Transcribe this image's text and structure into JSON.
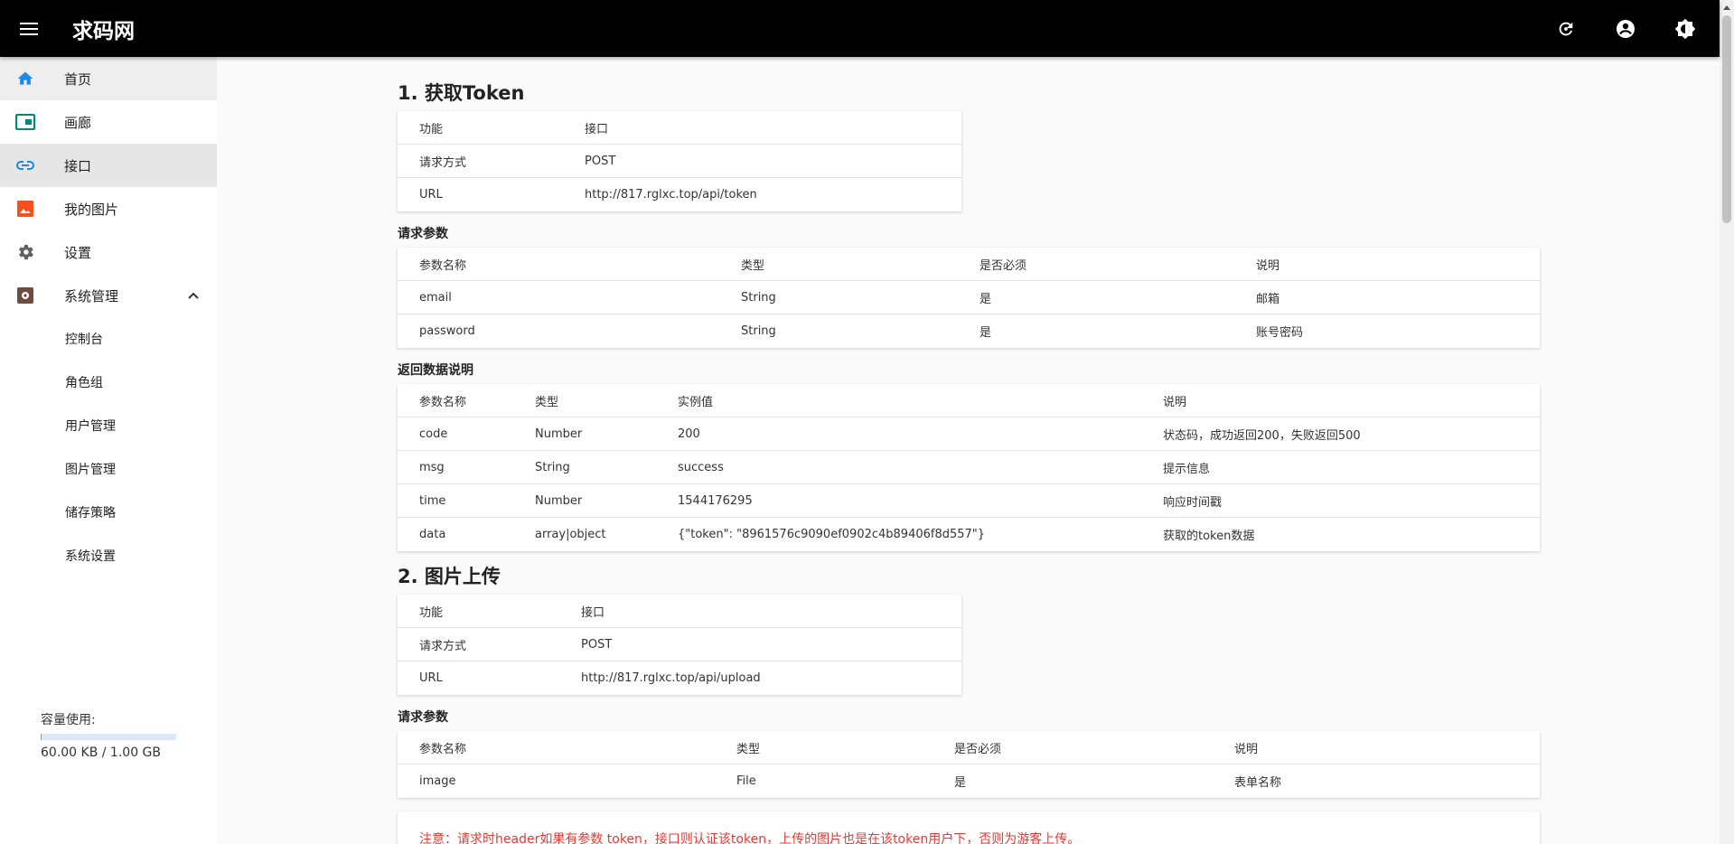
{
  "app": {
    "title": "求码网"
  },
  "sidebar": {
    "items": [
      {
        "label": "首页",
        "icon": "home-icon"
      },
      {
        "label": "画廊",
        "icon": "gallery-icon"
      },
      {
        "label": "接口",
        "icon": "link-icon"
      },
      {
        "label": "我的图片",
        "icon": "image-icon"
      },
      {
        "label": "设置",
        "icon": "gear-icon"
      },
      {
        "label": "系统管理",
        "icon": "admin-icon"
      }
    ],
    "sub_items": [
      "控制台",
      "角色组",
      "用户管理",
      "图片管理",
      "储存策略",
      "系统设置"
    ],
    "usage": {
      "label": "容量使用:",
      "value": "60.00 KB / 1.00 GB",
      "fraction": 6e-05
    }
  },
  "sections": {
    "token": {
      "heading": "1. 获取Token",
      "info": [
        [
          "功能",
          "接口"
        ],
        [
          "请求方式",
          "POST"
        ],
        [
          "URL",
          "http://817.rglxc.top/api/token"
        ]
      ],
      "params_title": "请求参数",
      "params_header": [
        "参数名称",
        "类型",
        "是否必须",
        "说明"
      ],
      "params": [
        [
          "email",
          "String",
          "是",
          "邮箱"
        ],
        [
          "password",
          "String",
          "是",
          "账号密码"
        ]
      ],
      "return_title": "返回数据说明",
      "return_header": [
        "参数名称",
        "类型",
        "实例值",
        "说明"
      ],
      "returns": [
        [
          "code",
          "Number",
          "200",
          "状态码，成功返回200，失败返回500"
        ],
        [
          "msg",
          "String",
          "success",
          "提示信息"
        ],
        [
          "time",
          "Number",
          "1544176295",
          "响应时间戳"
        ],
        [
          "data",
          "array|object",
          "{\"token\": \"8961576c9090ef0902c4b89406f8d557\"}",
          "获取的token数据"
        ]
      ]
    },
    "upload": {
      "heading": "2. 图片上传",
      "info": [
        [
          "功能",
          "接口"
        ],
        [
          "请求方式",
          "POST"
        ],
        [
          "URL",
          "http://817.rglxc.top/api/upload"
        ]
      ],
      "params_title": "请求参数",
      "params_header": [
        "参数名称",
        "类型",
        "是否必须",
        "说明"
      ],
      "params": [
        [
          "image",
          "File",
          "是",
          "表单名称"
        ]
      ],
      "notice": "注意：请求时header如果有参数 token，接口则认证该token，上传的图片也是在该token用户下，否则为游客上传。"
    }
  }
}
